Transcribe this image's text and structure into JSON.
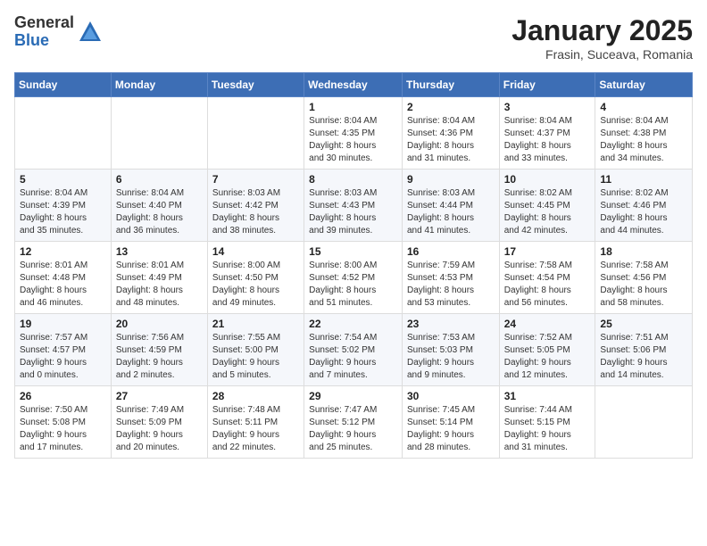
{
  "logo": {
    "general": "General",
    "blue": "Blue"
  },
  "title": "January 2025",
  "location": "Frasin, Suceava, Romania",
  "days_header": [
    "Sunday",
    "Monday",
    "Tuesday",
    "Wednesday",
    "Thursday",
    "Friday",
    "Saturday"
  ],
  "weeks": [
    [
      {
        "day": "",
        "info": ""
      },
      {
        "day": "",
        "info": ""
      },
      {
        "day": "",
        "info": ""
      },
      {
        "day": "1",
        "info": "Sunrise: 8:04 AM\nSunset: 4:35 PM\nDaylight: 8 hours\nand 30 minutes."
      },
      {
        "day": "2",
        "info": "Sunrise: 8:04 AM\nSunset: 4:36 PM\nDaylight: 8 hours\nand 31 minutes."
      },
      {
        "day": "3",
        "info": "Sunrise: 8:04 AM\nSunset: 4:37 PM\nDaylight: 8 hours\nand 33 minutes."
      },
      {
        "day": "4",
        "info": "Sunrise: 8:04 AM\nSunset: 4:38 PM\nDaylight: 8 hours\nand 34 minutes."
      }
    ],
    [
      {
        "day": "5",
        "info": "Sunrise: 8:04 AM\nSunset: 4:39 PM\nDaylight: 8 hours\nand 35 minutes."
      },
      {
        "day": "6",
        "info": "Sunrise: 8:04 AM\nSunset: 4:40 PM\nDaylight: 8 hours\nand 36 minutes."
      },
      {
        "day": "7",
        "info": "Sunrise: 8:03 AM\nSunset: 4:42 PM\nDaylight: 8 hours\nand 38 minutes."
      },
      {
        "day": "8",
        "info": "Sunrise: 8:03 AM\nSunset: 4:43 PM\nDaylight: 8 hours\nand 39 minutes."
      },
      {
        "day": "9",
        "info": "Sunrise: 8:03 AM\nSunset: 4:44 PM\nDaylight: 8 hours\nand 41 minutes."
      },
      {
        "day": "10",
        "info": "Sunrise: 8:02 AM\nSunset: 4:45 PM\nDaylight: 8 hours\nand 42 minutes."
      },
      {
        "day": "11",
        "info": "Sunrise: 8:02 AM\nSunset: 4:46 PM\nDaylight: 8 hours\nand 44 minutes."
      }
    ],
    [
      {
        "day": "12",
        "info": "Sunrise: 8:01 AM\nSunset: 4:48 PM\nDaylight: 8 hours\nand 46 minutes."
      },
      {
        "day": "13",
        "info": "Sunrise: 8:01 AM\nSunset: 4:49 PM\nDaylight: 8 hours\nand 48 minutes."
      },
      {
        "day": "14",
        "info": "Sunrise: 8:00 AM\nSunset: 4:50 PM\nDaylight: 8 hours\nand 49 minutes."
      },
      {
        "day": "15",
        "info": "Sunrise: 8:00 AM\nSunset: 4:52 PM\nDaylight: 8 hours\nand 51 minutes."
      },
      {
        "day": "16",
        "info": "Sunrise: 7:59 AM\nSunset: 4:53 PM\nDaylight: 8 hours\nand 53 minutes."
      },
      {
        "day": "17",
        "info": "Sunrise: 7:58 AM\nSunset: 4:54 PM\nDaylight: 8 hours\nand 56 minutes."
      },
      {
        "day": "18",
        "info": "Sunrise: 7:58 AM\nSunset: 4:56 PM\nDaylight: 8 hours\nand 58 minutes."
      }
    ],
    [
      {
        "day": "19",
        "info": "Sunrise: 7:57 AM\nSunset: 4:57 PM\nDaylight: 9 hours\nand 0 minutes."
      },
      {
        "day": "20",
        "info": "Sunrise: 7:56 AM\nSunset: 4:59 PM\nDaylight: 9 hours\nand 2 minutes."
      },
      {
        "day": "21",
        "info": "Sunrise: 7:55 AM\nSunset: 5:00 PM\nDaylight: 9 hours\nand 5 minutes."
      },
      {
        "day": "22",
        "info": "Sunrise: 7:54 AM\nSunset: 5:02 PM\nDaylight: 9 hours\nand 7 minutes."
      },
      {
        "day": "23",
        "info": "Sunrise: 7:53 AM\nSunset: 5:03 PM\nDaylight: 9 hours\nand 9 minutes."
      },
      {
        "day": "24",
        "info": "Sunrise: 7:52 AM\nSunset: 5:05 PM\nDaylight: 9 hours\nand 12 minutes."
      },
      {
        "day": "25",
        "info": "Sunrise: 7:51 AM\nSunset: 5:06 PM\nDaylight: 9 hours\nand 14 minutes."
      }
    ],
    [
      {
        "day": "26",
        "info": "Sunrise: 7:50 AM\nSunset: 5:08 PM\nDaylight: 9 hours\nand 17 minutes."
      },
      {
        "day": "27",
        "info": "Sunrise: 7:49 AM\nSunset: 5:09 PM\nDaylight: 9 hours\nand 20 minutes."
      },
      {
        "day": "28",
        "info": "Sunrise: 7:48 AM\nSunset: 5:11 PM\nDaylight: 9 hours\nand 22 minutes."
      },
      {
        "day": "29",
        "info": "Sunrise: 7:47 AM\nSunset: 5:12 PM\nDaylight: 9 hours\nand 25 minutes."
      },
      {
        "day": "30",
        "info": "Sunrise: 7:45 AM\nSunset: 5:14 PM\nDaylight: 9 hours\nand 28 minutes."
      },
      {
        "day": "31",
        "info": "Sunrise: 7:44 AM\nSunset: 5:15 PM\nDaylight: 9 hours\nand 31 minutes."
      },
      {
        "day": "",
        "info": ""
      }
    ]
  ]
}
